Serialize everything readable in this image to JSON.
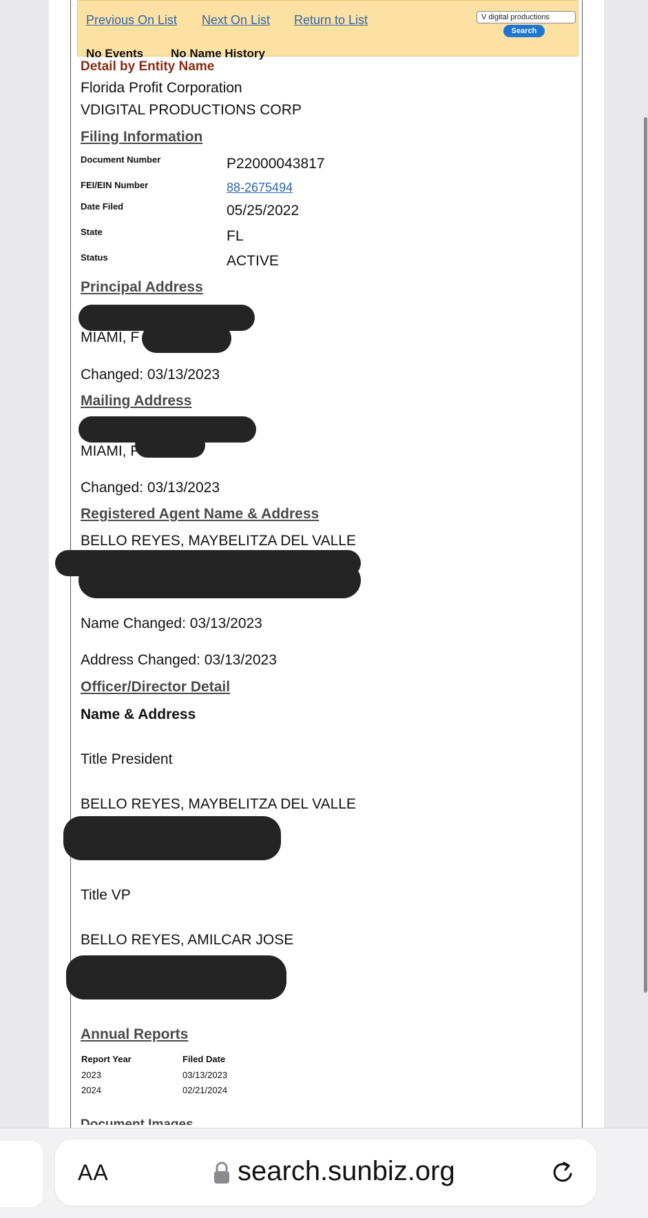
{
  "nav": {
    "previous": "Previous On List",
    "next": "Next On List",
    "return": "Return to List",
    "search_value": "V digital productions",
    "search_button": "Search",
    "no_events": "No Events",
    "no_name_history": "No Name History"
  },
  "detail": {
    "heading": "Detail by Entity Name",
    "entity_type": "Florida Profit Corporation",
    "entity_name": "VDIGITAL PRODUCTIONS CORP"
  },
  "filing": {
    "heading": "Filing Information",
    "rows": [
      {
        "label": "Document Number",
        "value": "P22000043817"
      },
      {
        "label": "FEI/EIN Number",
        "value": "88-2675494"
      },
      {
        "label": "Date Filed",
        "value": "05/25/2022"
      },
      {
        "label": "State",
        "value": "FL"
      },
      {
        "label": "Status",
        "value": "ACTIVE"
      }
    ]
  },
  "principal": {
    "heading": "Principal Address",
    "city": "MIAMI, F",
    "changed": "Changed: 03/13/2023"
  },
  "mailing": {
    "heading": "Mailing Address",
    "city": "MIAMI, F",
    "changed": "Changed: 03/13/2023"
  },
  "agent": {
    "heading": "Registered Agent Name & Address",
    "name": "BELLO REYES, MAYBELITZA DEL VALLE",
    "name_changed": "Name Changed: 03/13/2023",
    "address_changed": "Address Changed: 03/13/2023"
  },
  "officers": {
    "heading": "Officer/Director Detail",
    "subheading": "Name & Address",
    "list": [
      {
        "title": "Title President",
        "name": "BELLO REYES, MAYBELITZA DEL VALLE"
      },
      {
        "title": "Title VP",
        "name": "BELLO REYES, AMILCAR JOSE"
      }
    ]
  },
  "annual_reports": {
    "heading": "Annual Reports",
    "columns": [
      "Report Year",
      "Filed Date"
    ],
    "rows": [
      [
        "2023",
        "03/13/2023"
      ],
      [
        "2024",
        "02/21/2024"
      ]
    ]
  },
  "document_images": {
    "heading": "Document Images"
  },
  "browser": {
    "aa": "AA",
    "url": "search.sunbiz.org"
  },
  "colors": {
    "topbar": "#fde1a3",
    "link": "#2f67a8",
    "heading_red": "#8b2a12",
    "search_button": "#1e75d6"
  }
}
